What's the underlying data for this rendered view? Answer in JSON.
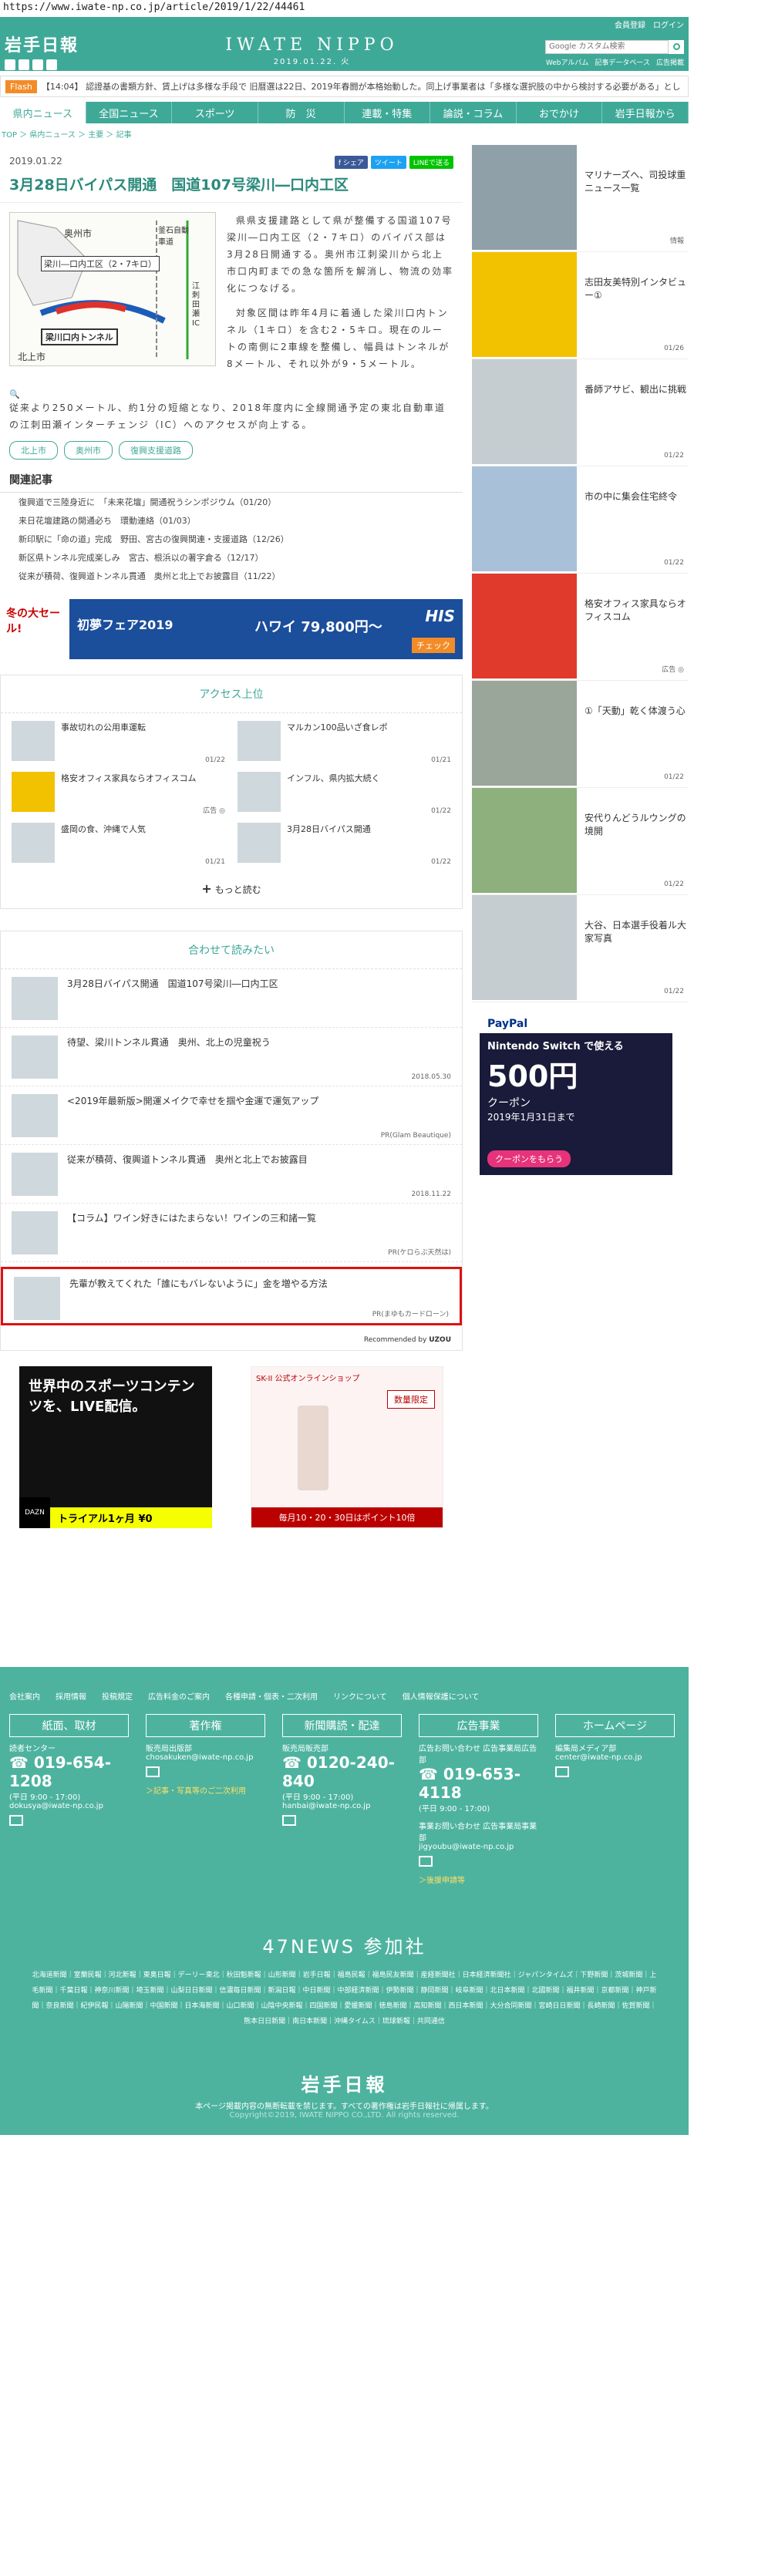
{
  "url": "https://www.iwate-np.co.jp/article/2019/1/22/44461",
  "header": {
    "logo_jp": "岩手日報",
    "logo_en": "IWATE NIPPO",
    "date": "2019.01.22. 火",
    "links": [
      "会員登録",
      "ログイン"
    ],
    "search_placeholder": "Google カスタム検索",
    "sublinks": [
      "Webアルバム",
      "記事データベース",
      "広告掲載"
    ]
  },
  "flash": {
    "tag": "Flash",
    "text": "【14:04】  認證基の書類方針、賃上げは多様な手段で   旧暦選は22日、2019年春闘が本格始動した。同上げ事業者は「多様な選択肢の中から検討する必要がある」とし"
  },
  "nav": [
    "県内ニュース",
    "全国ニュース",
    "スポーツ",
    "防　災",
    "連載・特集",
    "論説・コラム",
    "おでかけ",
    "岩手日報から"
  ],
  "breadcrumb": "TOP ＞ 県内ニュース ＞ 主要 ＞ 記事",
  "article": {
    "date": "2019.01.22",
    "share": [
      "f シェア",
      "ツイート",
      "LINEで送る"
    ],
    "title": "3月28日バイパス開通　国道107号梁川―口内工区",
    "map_labels": {
      "top": "奥州市",
      "road": "梁川―口内工区（2・7キロ）",
      "car": "釜石自動車道",
      "tunnel": "梁川口内トンネル",
      "bottom": "北上市",
      "ic": "江刺田瀬IC"
    },
    "p1": "県県支援建路として県が整備する国道107号梁川―口内工区（2・7キロ）のバイパス部は3月28日開通する。奥州市江刺梁川から北上市口内町までの急な箇所を解消し、物流の効率化につなげる。",
    "p2": "対象区間は昨年4月に着通した梁川口内トンネル（1キロ）を含む2・5キロ。現在のルートの南側に2車線を整備し、幅員はトンネルが8メートル、それ以外が9・5メートル。",
    "p3": "従来より250メートル、約1分の短縮となり、2018年度内に全線開通予定の東北自動車道の江刺田瀬インターチェンジ（IC）へのアクセスが向上する。",
    "tags": [
      "北上市",
      "奥州市",
      "復興支援道路"
    ]
  },
  "related": {
    "heading": "関連記事",
    "items": [
      "復興道で三陸身近に　「未来花壇」開通祝うシンポジウム（01/20）",
      "来日花壇建路の開通必ち　環動連絡（01/03）",
      "新印駅に「命の道」完成　野田、宮古の復興関連・支援道路（12/26）",
      "新区県トンネル完成楽しみ　宮古、根浜以の著字倉る（12/17）",
      "従来が積荷、復興道トンネル貫通　奥州と北上でお披露目（11/22）"
    ]
  },
  "ad_banner": {
    "left": "冬の大セール!",
    "mid": "初夢フェア2019",
    "price": "ハワイ 79,800円〜",
    "brand": "HIS",
    "cta": "チェック"
  },
  "ranking": {
    "heading": "アクセス上位",
    "items": [
      {
        "title": "事故切れの公用車運転",
        "date": "01/22"
      },
      {
        "title": "マルカン100品いざ食レポ",
        "date": "01/21"
      },
      {
        "title": "格安オフィス家具ならオフィスコム",
        "date": "広告 ◎"
      },
      {
        "title": "インフル、県内拡大続く",
        "date": "01/22"
      },
      {
        "title": "盛岡の食、沖縄で人気",
        "date": "01/21"
      },
      {
        "title": "3月28日バイパス開通",
        "date": "01/22"
      }
    ],
    "more": "もっと読む"
  },
  "recommend": {
    "heading": "合わせて読みたい",
    "items": [
      {
        "title": "3月28日バイパス開通　国道107号梁川―口内工区",
        "meta": ""
      },
      {
        "title": "待望、梁川トンネル貫通　奥州、北上の児童祝う",
        "meta": "2018.05.30"
      },
      {
        "title": "<2019年最新版>開運メイクで幸せを掴や金運で運気アップ",
        "meta": "PR(Glam Beautique)"
      },
      {
        "title": "従来が積荷、復興道トンネル貫通　奥州と北上でお披露目",
        "meta": "2018.11.22"
      },
      {
        "title": "【コラム】ワイン好きにはたまらない！ワインの三和諸一覧",
        "meta": "PR(ケロらぶ天然は)"
      },
      {
        "title": "先輩が教えてくれた「誰にもバレないように」金を増やる方法",
        "meta": "PR(まゆもカードローン)"
      }
    ],
    "brand": "Recommended by",
    "brand_name": "UZOU"
  },
  "bottom_ads": [
    {
      "title": "世界中のスポーツコンテンツを、LIVE配信。",
      "cta": "トライアル1ヶ月 ¥0",
      "brand": "DAZN"
    },
    {
      "title": "SK-II 公式オンラインショップ",
      "cta": "数量限定",
      "sub": "毎月10・20・30日はポイント10倍"
    }
  ],
  "sidebar": [
    {
      "title": "マリナーズへ、司投球重ニュース一覧",
      "date": "情報"
    },
    {
      "title": "志田友美特別インタビュー①",
      "date": "01/26"
    },
    {
      "title": "番師アサビ、観出に挑戦",
      "date": "01/22"
    },
    {
      "title": "市の中に集会住宅終令",
      "date": "01/22"
    },
    {
      "title": "格安オフィス家具ならオフィスコム",
      "date": "広告 ◎"
    },
    {
      "title": "①「天動」乾く体渡う心",
      "date": "01/22"
    },
    {
      "title": "安代りんどうルウングの境開",
      "date": "01/22"
    },
    {
      "title": "大谷、日本選手役着ル大家写真",
      "date": "01/22"
    }
  ],
  "side_ad": {
    "brand": "PayPal",
    "main": "Nintendo Switch で使える",
    "amount": "500円",
    "sub": "クーポン",
    "date": "2019年1月31日まで",
    "cta": "クーポンをもらう"
  },
  "footer": {
    "links": [
      "会社案内",
      "採用情報",
      "投稿規定",
      "広告料金のご案内",
      "各種申請・個表・二次利用",
      "リンクについて",
      "個人情報保護について"
    ],
    "cols": [
      {
        "head": "紙面、取材",
        "sub": "読者センター",
        "tel": "019-654-1208",
        "hours": "(平日 9:00 - 17:00)",
        "mail": "dokusya@iwate-np.co.jp",
        "extra": ""
      },
      {
        "head": "著作権",
        "sub": "販売局出版部",
        "tel": "",
        "hours": "",
        "mail": "chosakuken@iwate-np.co.jp",
        "extra": "＞記事・写真等のご二次利用"
      },
      {
        "head": "新聞購読・配達",
        "sub": "販売局販売部",
        "tel": "0120-240-840",
        "hours": "(平日 9:00 - 17:00)",
        "mail": "hanbai@iwate-np.co.jp",
        "extra": ""
      },
      {
        "head": "広告事業",
        "sub": "広告お問い合わせ 広告事業局広告部",
        "tel": "019-653-4118",
        "hours": "(平日 9:00 - 17:00)",
        "mail": "jigyoubu@iwate-np.co.jp",
        "extra": "＞後援申請等"
      },
      {
        "head": "ホームページ",
        "sub": "編集局メディア部",
        "tel": "",
        "hours": "",
        "mail": "center@iwate-np.co.jp",
        "extra": ""
      }
    ],
    "extra_sub": "事業お問い合わせ 広告事業局事業部",
    "news47": "47NEWS 参加社",
    "members": "北海道新聞｜室蘭民報｜河北新報｜東奥日報｜デーリー東北｜秋田魁新報｜山形新聞｜岩手日報｜福島民報｜福島民友新聞｜産経新聞社｜日本経済新聞社｜ジャパンタイムズ｜下野新聞｜茨城新聞｜上毛新聞｜千葉日報｜神奈川新聞｜埼玉新聞｜山梨日日新聞｜信濃毎日新聞｜新潟日報｜中日新聞｜中部経済新聞｜伊勢新聞｜静岡新聞｜岐阜新聞｜北日本新聞｜北國新聞｜福井新聞｜京都新聞｜神戸新聞｜奈良新聞｜紀伊民報｜山陽新聞｜中国新聞｜日本海新聞｜山口新聞｜山陰中央新報｜四国新聞｜愛媛新聞｜徳島新聞｜高知新聞｜西日本新聞｜大分合同新聞｜宮崎日日新聞｜長崎新聞｜佐賀新聞｜熊本日日新聞｜南日本新聞｜沖縄タイムス｜琉球新報｜共同通信",
    "logo": "岩手日報",
    "copy": "本ページ掲載内容の無断転載を禁じます。すべての著作権は岩手日報社に帰属します。",
    "copy2": "Copyright©2019, IWATE NIPPO CO.,LTD. All rights reserved."
  }
}
